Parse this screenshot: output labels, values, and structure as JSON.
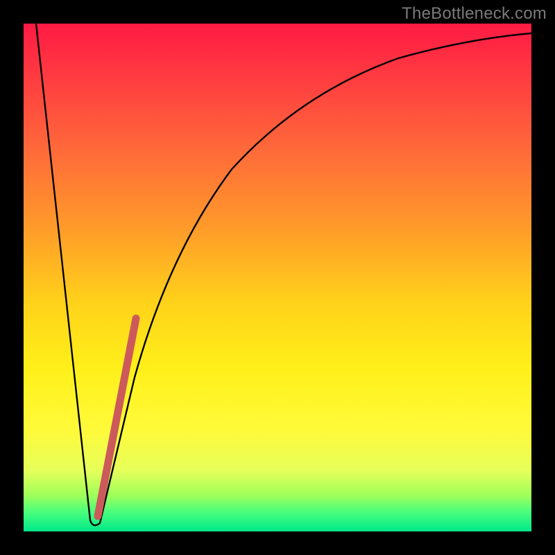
{
  "watermark": "TheBottleneck.com",
  "colors": {
    "frame": "#000000",
    "curve": "#000000",
    "segment": "#cc5a5a",
    "gradient_top": "#ff1a44",
    "gradient_bottom": "#00e88a"
  },
  "chart_data": {
    "type": "line",
    "title": "",
    "xlabel": "",
    "ylabel": "",
    "xlim": [
      0,
      100
    ],
    "ylim": [
      0,
      100
    ],
    "grid": false,
    "series": [
      {
        "name": "bottleneck-curve",
        "x": [
          2,
          5,
          8,
          10,
          12,
          13,
          14,
          16,
          18,
          20,
          24,
          28,
          34,
          42,
          52,
          64,
          78,
          92,
          100
        ],
        "values": [
          100,
          72,
          44,
          22,
          6,
          1,
          3,
          14,
          28,
          40,
          56,
          66,
          76,
          84,
          90,
          93,
          95,
          96.5,
          97
        ]
      }
    ],
    "annotations": [
      {
        "name": "highlight-segment",
        "type": "line-segment",
        "x0": 14.5,
        "y0": 3,
        "x1": 21.5,
        "y1": 42,
        "stroke_width_px": 11,
        "color": "#cc5a5a"
      }
    ]
  }
}
